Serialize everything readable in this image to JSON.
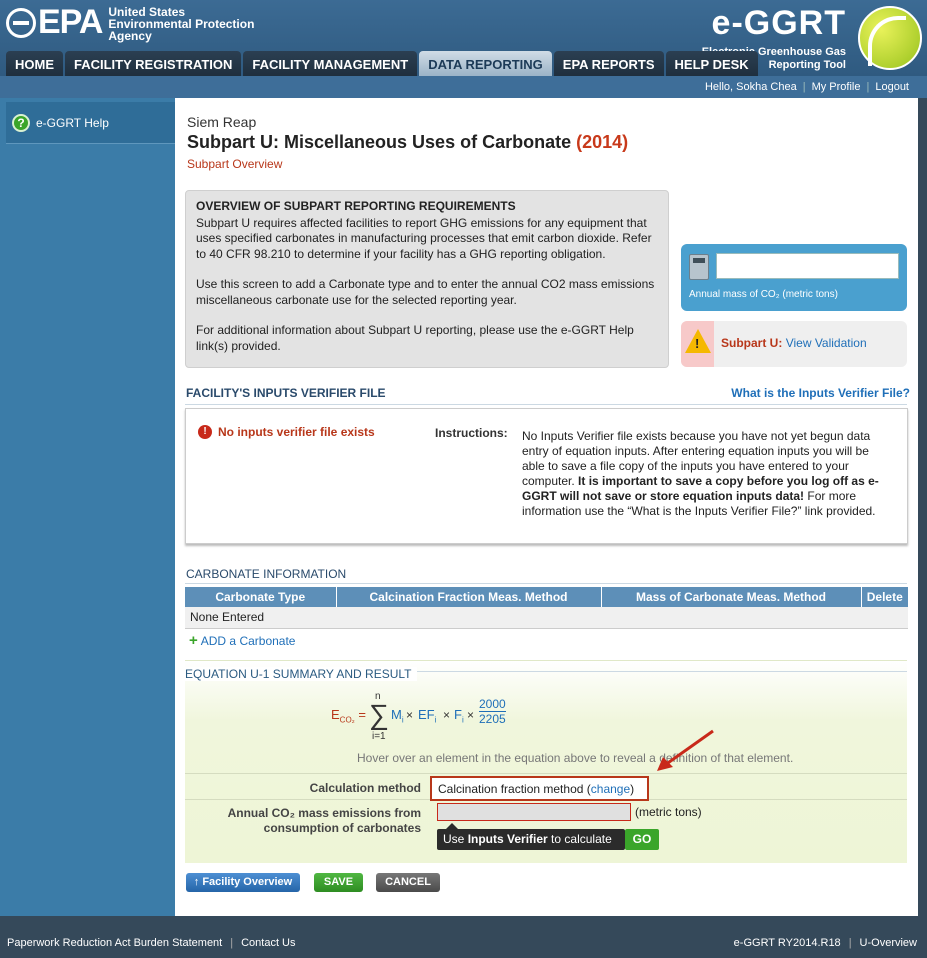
{
  "header": {
    "agency_short": "EPA",
    "agency_long": [
      "United States",
      "Environmental Protection",
      "Agency"
    ],
    "app_title": "e-GGRT",
    "app_subtitle": [
      "Electronic Greenhouse Gas",
      "Reporting Tool"
    ]
  },
  "tabs": [
    "HOME",
    "FACILITY REGISTRATION",
    "FACILITY MANAGEMENT",
    "DATA REPORTING",
    "EPA REPORTS",
    "HELP DESK"
  ],
  "active_tab": "DATA REPORTING",
  "userbar": {
    "greeting": "Hello, Sokha Chea",
    "profile": "My Profile",
    "logout": "Logout"
  },
  "sidebar": {
    "help_label": "e-GGRT Help"
  },
  "page": {
    "facility": "Siem Reap",
    "title": "Subpart U: Miscellaneous Uses of Carbonate",
    "year": "(2014)",
    "subtitle": "Subpart Overview"
  },
  "overview": {
    "heading": "OVERVIEW OF SUBPART REPORTING REQUIREMENTS",
    "p1": "Subpart U requires affected facilities to report GHG emissions for any equipment that uses specified carbonates in manufacturing processes that emit carbon dioxide. Refer to 40 CFR 98.210 to determine if your facility has a GHG reporting obligation.",
    "p2": "Use this screen to add a Carbonate type and to enter the annual CO2 mass emissions miscellaneous carbonate use for the selected reporting year.",
    "p3": "For additional information about Subpart U reporting, please use the e-GGRT Help link(s) provided."
  },
  "calc_box": {
    "value": "",
    "label": "Annual mass of CO₂ (metric tons)"
  },
  "validation": {
    "label": "Subpart U:",
    "link": "View Validation"
  },
  "verifier": {
    "section_title": "FACILITY'S INPUTS VERIFIER FILE",
    "help_link": "What is the Inputs Verifier File?",
    "status": "No inputs verifier file exists",
    "instr_label": "Instructions:",
    "instr_text_1": "No Inputs Verifier file exists because you have not yet begun data entry of equation inputs.  After entering equation inputs you will be able to save a file copy of the inputs you have entered to your computer.  ",
    "instr_bold": "It is important to save a copy before you log off as e-GGRT will not save or store equation inputs data!",
    "instr_text_2": " For more information use the “What is the Inputs Verifier File?” link provided."
  },
  "carbonate": {
    "section_title": "CARBONATE INFORMATION",
    "columns": [
      "Carbonate Type",
      "Calcination Fraction Meas. Method",
      "Mass of Carbonate Meas. Method",
      "Delete"
    ],
    "empty_text": "None Entered",
    "add_link": "ADD a Carbonate"
  },
  "equation": {
    "section_title": "EQUATION U-1 SUMMARY AND RESULT",
    "lhs": "E",
    "lhs_sub": "CO₂",
    "sum_upper": "n",
    "sum_lower": "i=1",
    "term_m": "M",
    "term_ef": "EF",
    "term_f": "F",
    "sub_i": "i",
    "times": "×",
    "frac_num": "2000",
    "frac_den": "2205",
    "hover_note": "Hover over an element in the equation above to reveal a definition of that element."
  },
  "calc_method": {
    "label": "Calculation method",
    "value": "Calcination fraction method",
    "change_link": "change"
  },
  "annual_mass": {
    "label_1": "Annual CO₂ mass emissions from",
    "label_2": "consumption of carbonates",
    "value": "",
    "unit": "(metric tons)",
    "verifier_prefix": "Use ",
    "verifier_bold": "Inputs Verifier",
    "verifier_suffix": " to calculate",
    "go": "GO"
  },
  "buttons": {
    "facility_overview": "Facility Overview",
    "save": "SAVE",
    "cancel": "CANCEL"
  },
  "footer": {
    "paperwork": "Paperwork Reduction Act Burden Statement",
    "contact": "Contact Us",
    "version": "e-GGRT RY2014.R18",
    "page_id": "U-Overview"
  }
}
